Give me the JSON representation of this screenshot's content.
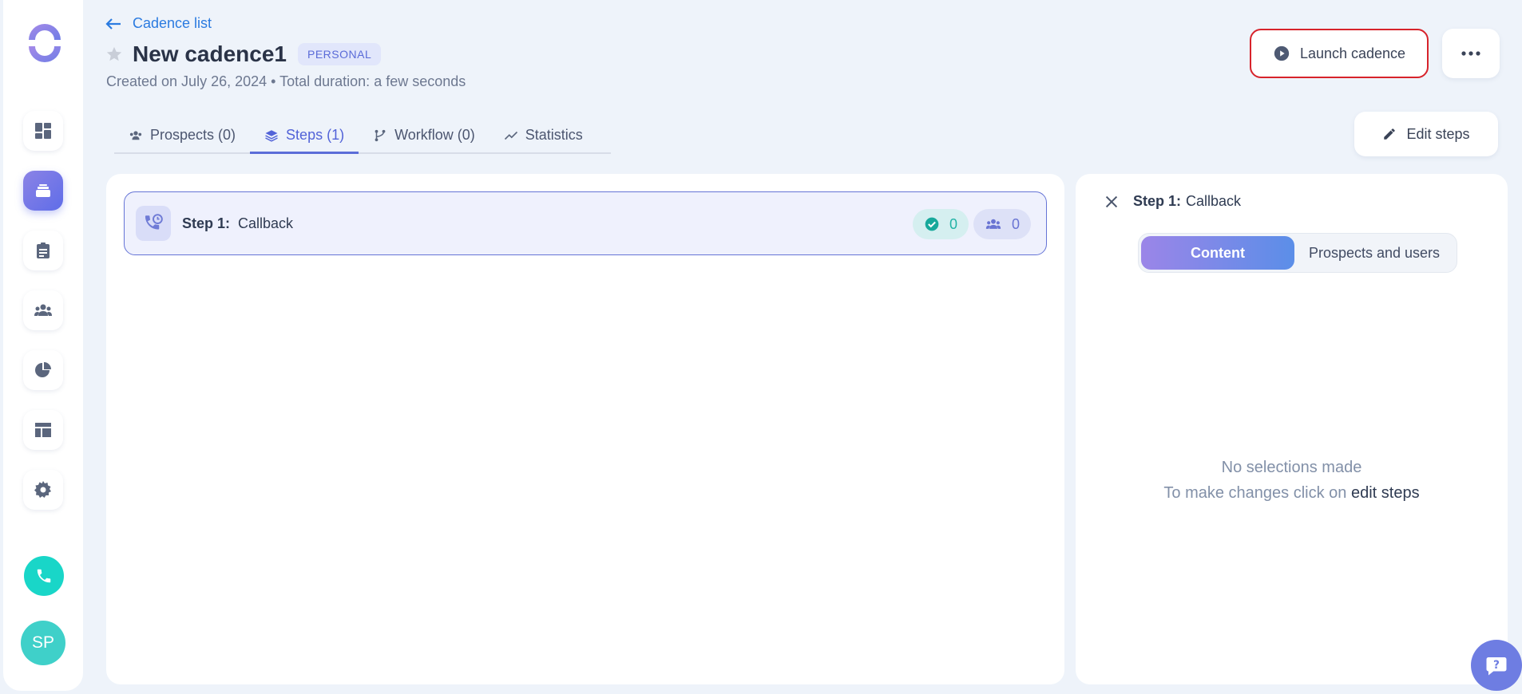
{
  "header": {
    "back_label": "Cadence list",
    "title": "New cadence1",
    "badge": "PERSONAL",
    "subtitle": "Created on July 26, 2024 • Total duration: a few seconds",
    "launch_label": "Launch cadence",
    "edit_steps_label": "Edit steps"
  },
  "tabs": [
    {
      "label": "Prospects (0)",
      "icon": "people-icon"
    },
    {
      "label": "Steps (1)",
      "icon": "layers-icon",
      "active": true
    },
    {
      "label": "Workflow (0)",
      "icon": "branch-icon"
    },
    {
      "label": "Statistics",
      "icon": "trend-icon"
    }
  ],
  "sidebar": {
    "items": [
      "dashboard-icon",
      "cadences-icon",
      "tasks-icon",
      "prospects-icon",
      "reports-icon",
      "templates-icon",
      "settings-icon"
    ],
    "avatar_initials": "SP"
  },
  "step": {
    "label": "Step 1:",
    "name": "Callback",
    "done_count": "0",
    "prospects_count": "0"
  },
  "side_panel": {
    "title_label": "Step 1:",
    "title_name": "Callback",
    "segments": [
      "Content",
      "Prospects and users"
    ],
    "empty_line1": "No selections made",
    "empty_line2": "To make changes click on",
    "empty_link": "edit steps"
  },
  "colors": {
    "accent": "#5c6dd8",
    "launch_border": "#d7232b",
    "call": "#19d6c8"
  }
}
